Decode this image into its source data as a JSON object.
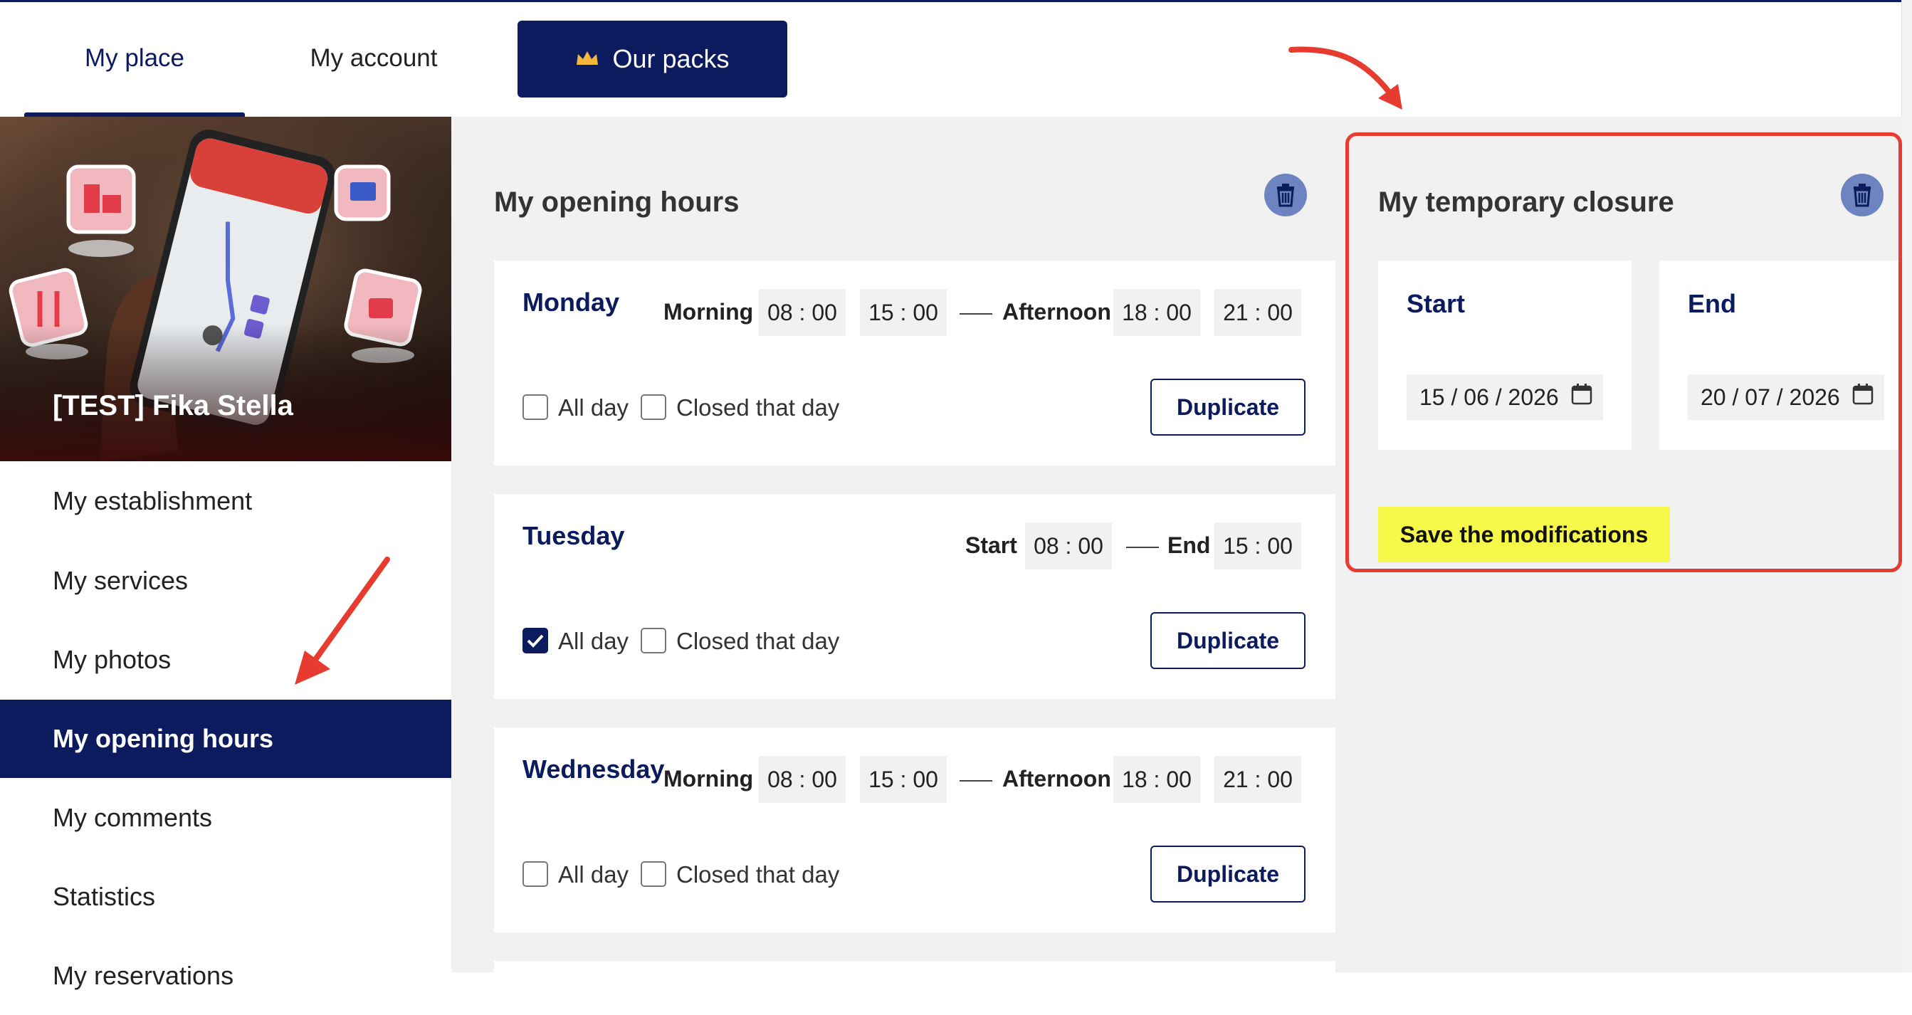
{
  "nav": {
    "tabs": [
      {
        "label": "My place"
      },
      {
        "label": "My account"
      }
    ],
    "packs_label": "Our packs",
    "packs_icon": "crown-icon"
  },
  "sidebar": {
    "place_name": "[TEST] Fika Stella",
    "items": [
      {
        "label": "My establishment"
      },
      {
        "label": "My services"
      },
      {
        "label": "My photos"
      },
      {
        "label": "My opening hours"
      },
      {
        "label": "My comments"
      },
      {
        "label": "Statistics"
      },
      {
        "label": "My reservations"
      }
    ]
  },
  "opening_hours": {
    "title": "My opening hours",
    "days": [
      {
        "name": "Monday",
        "morning_label": "Morning",
        "morning_start": "08 : 00",
        "morning_end": "15 : 00",
        "afternoon_label": "Afternoon",
        "afternoon_start": "18 : 00",
        "afternoon_end": "21 : 00",
        "all_day_label": "All day",
        "all_day": false,
        "closed_label": "Closed that day",
        "closed": false,
        "duplicate_label": "Duplicate"
      },
      {
        "name": "Tuesday",
        "start_label": "Start",
        "start": "08 : 00",
        "end_label": "End",
        "end": "15 : 00",
        "all_day_label": "All day",
        "all_day": true,
        "closed_label": "Closed that day",
        "closed": false,
        "duplicate_label": "Duplicate"
      },
      {
        "name": "Wednesday",
        "morning_label": "Morning",
        "morning_start": "08 : 00",
        "morning_end": "15 : 00",
        "afternoon_label": "Afternoon",
        "afternoon_start": "18 : 00",
        "afternoon_end": "21 : 00",
        "all_day_label": "All day",
        "all_day": false,
        "closed_label": "Closed that day",
        "closed": false,
        "duplicate_label": "Duplicate"
      }
    ]
  },
  "temporary_closure": {
    "title": "My temporary closure",
    "start_label": "Start",
    "start_date": "15 / 06 / 2026",
    "end_label": "End",
    "end_date": "20 / 07 / 2026",
    "save_label": "Save the modifications"
  },
  "colors": {
    "brand_navy": "#0c1a5e",
    "save_yellow": "#f6f84a",
    "highlight_red": "#e63b2e",
    "trash_blue": "#6d84c0"
  }
}
